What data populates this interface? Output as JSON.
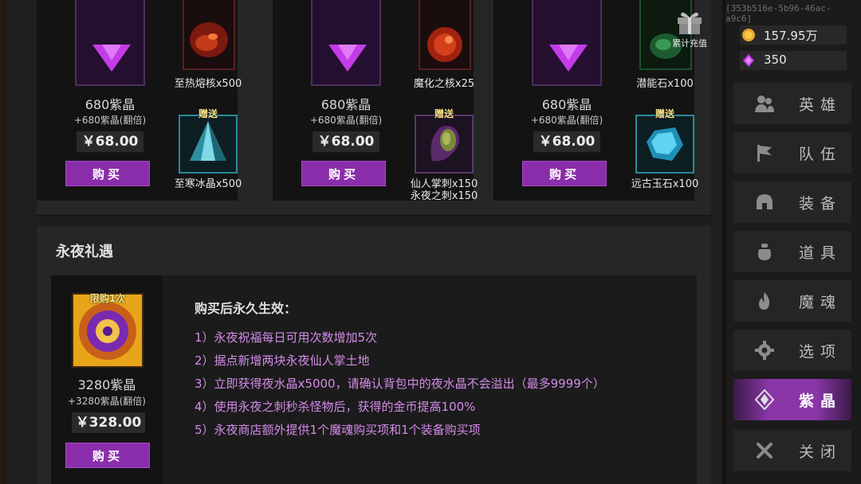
{
  "session_id": "[353b516e-5b96-46ac-a9c6]",
  "gift_button": {
    "label": "累计充值",
    "icon": "gift-icon"
  },
  "top_cards": [
    {
      "amount": "680紫晶",
      "bonus": "+680紫晶(翻倍)",
      "price": "￥68.00",
      "buy": "购买",
      "item_top_label": "至热熔核x500",
      "item_bottom_gift": "赠送",
      "item_bottom_label": "至寒冰晶x500"
    },
    {
      "amount": "680紫晶",
      "bonus": "+680紫晶(翻倍)",
      "price": "￥68.00",
      "buy": "购买",
      "item_top_label": "魔化之核x25",
      "item_bottom_gift": "赠送",
      "item_bottom_label_1": "仙人掌刺x150",
      "item_bottom_label_2": "永夜之刺x150"
    },
    {
      "amount": "680紫晶",
      "bonus": "+680紫晶(翻倍)",
      "price": "￥68.00",
      "buy": "购买",
      "item_top_label": "潜能石x100",
      "item_bottom_gift": "赠送",
      "item_bottom_label": "远古玉石x100"
    }
  ],
  "night_offer": {
    "title": "永夜礼遇",
    "limit": "限购1次",
    "amount": "3280紫晶",
    "bonus": "+3280紫晶(翻倍)",
    "price": "￥328.00",
    "buy": "购买",
    "benefits_heading": "购买后永久生效：",
    "benefits": [
      "1）永夜祝福每日可用次数增加5次",
      "2）据点新增两块永夜仙人掌土地",
      "3）立即获得夜水晶x5000，请确认背包中的夜水晶不会溢出（最多9999个）",
      "4）使用永夜之刺秒杀怪物后，获得的金币提高100%",
      "5）永夜商店额外提供1个魔魂购买项和1个装备购买项"
    ]
  },
  "currencies": [
    {
      "icon": "gold-coin-icon",
      "value": "157.95万"
    },
    {
      "icon": "purple-crystal-icon",
      "value": "350"
    }
  ],
  "nav": [
    {
      "label": "英雄",
      "icon": "heroes-icon"
    },
    {
      "label": "队伍",
      "icon": "flag-icon"
    },
    {
      "label": "装备",
      "icon": "helmet-icon"
    },
    {
      "label": "道具",
      "icon": "bag-icon"
    },
    {
      "label": "魔魂",
      "icon": "flame-icon"
    },
    {
      "label": "选项",
      "icon": "gear-icon"
    },
    {
      "label": "紫晶",
      "icon": "crystal-icon",
      "active": true
    },
    {
      "label": "关闭",
      "icon": "close-icon"
    }
  ],
  "colors": {
    "accent": "#8a2dab",
    "benefit_text": "#d38be8",
    "gift_tag": "#f4e08a"
  }
}
